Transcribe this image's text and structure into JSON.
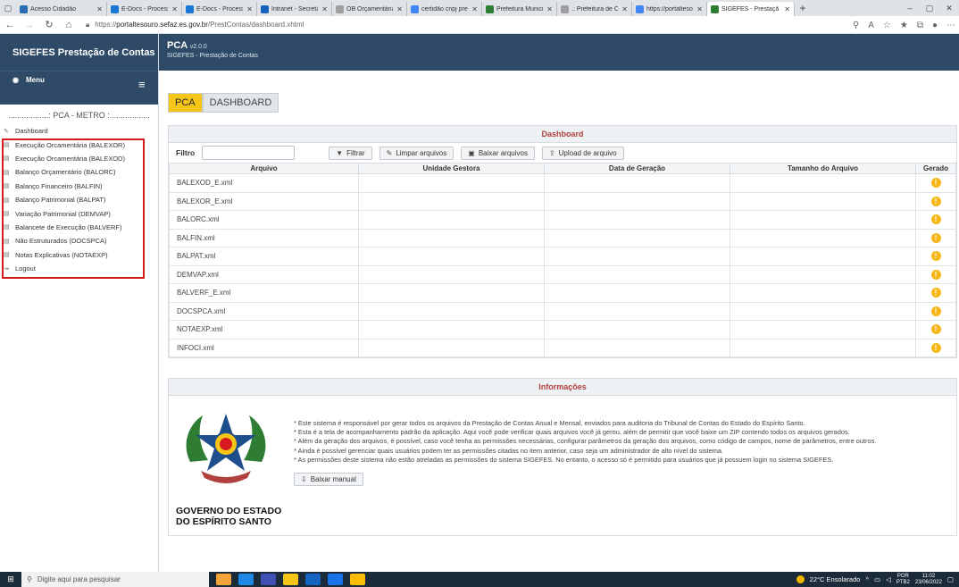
{
  "browser": {
    "tabs": [
      {
        "label": "Acesso Cidadão",
        "color": "#2b6cb0",
        "active": false
      },
      {
        "label": "E-Docs - Processo",
        "color": "#1976d2",
        "active": false
      },
      {
        "label": "E-Docs - Processos",
        "color": "#1976d2",
        "active": false
      },
      {
        "label": "Intranet - Secretar",
        "color": "#1565c0",
        "active": false
      },
      {
        "label": "OB Orçamentária",
        "color": "#9e9e9e",
        "active": false
      },
      {
        "label": "certidão cnpj prefe",
        "color": "#4285f4",
        "active": false
      },
      {
        "label": "Prefeitura Municip",
        "color": "#2e7d32",
        "active": false
      },
      {
        "label": ".: Prefeitura de Ca",
        "color": "#9e9e9e",
        "active": false
      },
      {
        "label": "https://portaltesou",
        "color": "#4285f4",
        "active": false
      },
      {
        "label": "SIGEFES - Prestaçã",
        "color": "#2e7d32",
        "active": true
      }
    ],
    "url_prefix": "https://",
    "url_host": "portaltesouro.sefaz.es.gov.br",
    "url_path": "/PrestContas/dashboard.xhtml",
    "new_tab": "+",
    "minimize": "–",
    "restore": "▢",
    "close": "✕"
  },
  "sidebar": {
    "brand": "SIGEFES Prestação de Contas",
    "menu_label": "Menu",
    "section_title": "..................: PCA - METRO :..................",
    "items": [
      {
        "label": "Dashboard",
        "icon": "edit-icon"
      },
      {
        "label": "Execução Orcamentária (BALEXOR)",
        "icon": "file-icon"
      },
      {
        "label": "Execução Orcamentária (BALEXOD)",
        "icon": "file-icon"
      },
      {
        "label": "Balanço Orçamentário (BALORC)",
        "icon": "file-icon"
      },
      {
        "label": "Balanço Financeiro (BALFIN)",
        "icon": "file-icon"
      },
      {
        "label": "Balanço Patrimonial (BALPAT)",
        "icon": "file-icon"
      },
      {
        "label": "Variação Patrimonial (DEMVAP)",
        "icon": "file-icon"
      },
      {
        "label": "Balancete de Execução (BALVERF)",
        "icon": "file-icon"
      },
      {
        "label": "Não Estruturados (DOCSPCA)",
        "icon": "file-icon"
      },
      {
        "label": "Notas Explicativas (NOTAEXP)",
        "icon": "file-icon"
      },
      {
        "label": "Logout",
        "icon": "logout-icon"
      }
    ]
  },
  "header": {
    "title": "PCA",
    "version": "v2.0.0",
    "subtitle": "SIGEFES - Prestação de Contas"
  },
  "page_tabs": [
    {
      "label": "PCA",
      "active": true
    },
    {
      "label": "DASHBOARD",
      "active": false
    }
  ],
  "dashboard": {
    "title": "Dashboard",
    "filter_label": "Filtro",
    "filter_value": "",
    "buttons": {
      "filter": "Filtrar",
      "clear": "Limpar arquivos",
      "download": "Baixar arquivos",
      "upload": "Upload de arquivo"
    },
    "columns": [
      "Arquivo",
      "Unidade Gestora",
      "Data de Geração",
      "Tamanho do Arquivo",
      "Gerado"
    ],
    "rows": [
      {
        "file": "BALEXOD_E.xml",
        "ug": "",
        "date": "",
        "size": "",
        "status": "!"
      },
      {
        "file": "BALEXOR_E.xml",
        "ug": "",
        "date": "",
        "size": "",
        "status": "!"
      },
      {
        "file": "BALORC.xml",
        "ug": "",
        "date": "",
        "size": "",
        "status": "!"
      },
      {
        "file": "BALFIN.xml",
        "ug": "",
        "date": "",
        "size": "",
        "status": "!"
      },
      {
        "file": "BALPAT.xml",
        "ug": "",
        "date": "",
        "size": "",
        "status": "!"
      },
      {
        "file": "DEMVAP.xml",
        "ug": "",
        "date": "",
        "size": "",
        "status": "!"
      },
      {
        "file": "BALVERF_E.xml",
        "ug": "",
        "date": "",
        "size": "",
        "status": "!"
      },
      {
        "file": "DOCSPCA.xml",
        "ug": "",
        "date": "",
        "size": "",
        "status": "!"
      },
      {
        "file": "NOTAEXP.xml",
        "ug": "",
        "date": "",
        "size": "",
        "status": "!"
      },
      {
        "file": "INFOCI.xml",
        "ug": "",
        "date": "",
        "size": "",
        "status": "!"
      }
    ]
  },
  "info": {
    "title": "Informações",
    "lines": [
      "* Este sistema é responsável por gerar todos os arquivos da Prestação de Contas Anual e Mensal, enviados para auditoria do Tribunal de Contas do Estado do Espírito Santo.",
      "* Esta é a tela de acompanhamento padrão da aplicação. Aqui você pode verificar quais arquivos você já gerou, além de permitir que você baixe um ZIP contendo todos os arquivos gerados.",
      "* Além da geração dos arquivos, é possível, caso você tenha as permissões necessárias, configurar parâmetros da geração dos arquivos, como código de campos, nome de parâmetros, entre outros.",
      "* Ainda é possível gerenciar quais usuários podem ter as permissões citadas no item anterior, caso seja um administrador de alto nível do sistema.",
      "* As permissões deste sistema não estão atreladas as permissões do sistema SIGEFES. No entanto, o acesso só é permitido para usuários que já possuem login no sistema SIGEFES."
    ],
    "manual_button": "Baixar manual",
    "gov_line1": "GOVERNO DO ESTADO",
    "gov_line2": "DO ESPÍRITO SANTO"
  },
  "taskbar": {
    "search_placeholder": "Digite aqui para pesquisar",
    "weather": "22°C Ensolarado",
    "lang": "POR",
    "lang2": "PTB2",
    "time": "11:02",
    "date": "23/06/2022"
  },
  "colors": {
    "header_bg": "#2e4a66",
    "accent_yellow": "#f5c518",
    "status_warning": "#f7b718",
    "highlight_red": "#d71920",
    "panel_title": "#b0413e"
  }
}
